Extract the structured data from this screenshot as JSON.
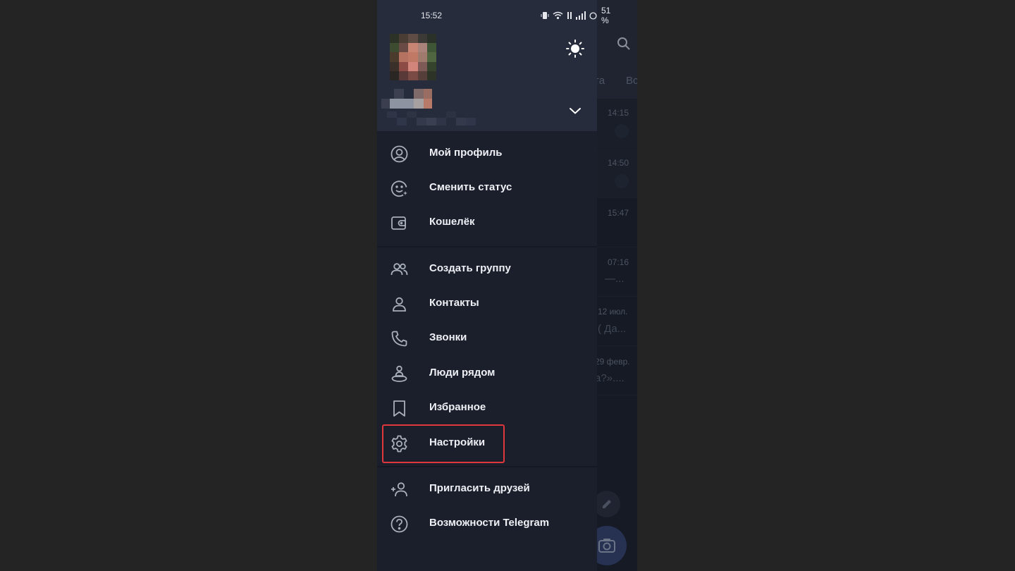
{
  "status_bar": {
    "time": "15:52",
    "battery": "51 %",
    "icons": [
      "vibrate-icon",
      "wifi-icon",
      "signal-icon",
      "battery-icon"
    ]
  },
  "background": {
    "tabs": [
      "та",
      "Вс"
    ],
    "chats": [
      {
        "time": "14:15",
        "pinned": true,
        "snippet": ""
      },
      {
        "time": "14:50",
        "pinned": true,
        "snippet": "",
        "check": true
      },
      {
        "time": "15:47",
        "pinned": true,
        "snippet": "",
        "check": true
      },
      {
        "time": "07:16",
        "pinned": false,
        "snippet": "—...",
        "check": true
      },
      {
        "time": "12 июл.",
        "pinned": false,
        "snippet": "( Да..."
      },
      {
        "time": "29 февр.",
        "pinned": false,
        "snippet": "а?»...."
      }
    ]
  },
  "drawer": {
    "menu_primary": [
      {
        "label": "Мой профиль",
        "icon": "profile-icon"
      },
      {
        "label": "Сменить статус",
        "icon": "emoji-status-icon"
      },
      {
        "label": "Кошелёк",
        "icon": "wallet-icon"
      }
    ],
    "menu_main": [
      {
        "label": "Создать группу",
        "icon": "group-icon"
      },
      {
        "label": "Контакты",
        "icon": "contact-icon"
      },
      {
        "label": "Звонки",
        "icon": "phone-icon"
      },
      {
        "label": "Люди рядом",
        "icon": "people-nearby-icon"
      },
      {
        "label": "Избранное",
        "icon": "bookmark-icon"
      },
      {
        "label": "Настройки",
        "icon": "gear-icon",
        "highlighted": true
      }
    ],
    "menu_secondary": [
      {
        "label": "Пригласить друзей",
        "icon": "add-user-icon"
      },
      {
        "label": "Возможности Telegram",
        "icon": "help-icon"
      }
    ]
  },
  "colors": {
    "drawer_bg": "#1b1f2b",
    "header_bg": "#272c3d",
    "highlight": "#e0373d"
  }
}
